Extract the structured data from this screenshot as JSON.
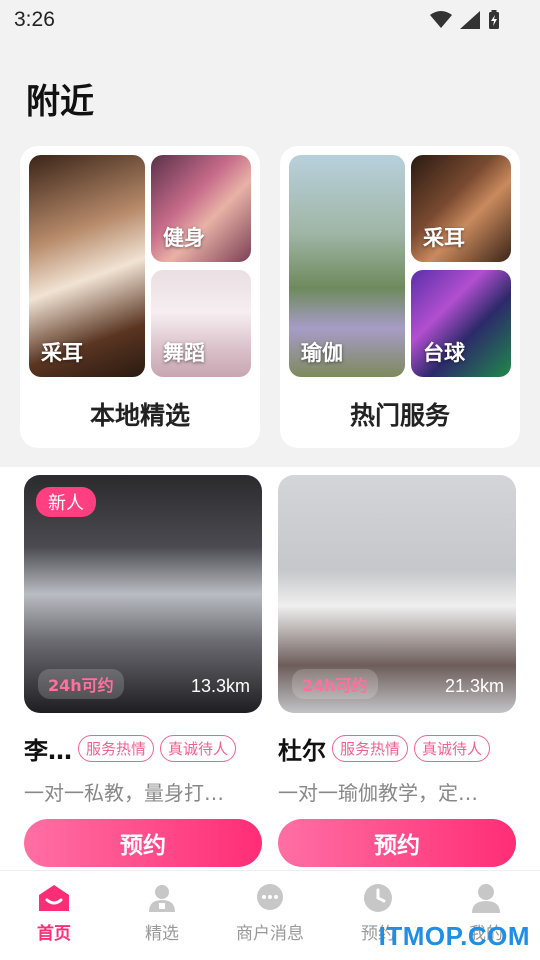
{
  "status_bar": {
    "time": "3:26"
  },
  "page_title": "附近",
  "features": [
    {
      "title": "本地精选",
      "tiles": [
        {
          "label": "采耳"
        },
        {
          "label": "健身"
        },
        {
          "label": "舞蹈"
        }
      ]
    },
    {
      "title": "热门服务",
      "tiles": [
        {
          "label": "瑜伽"
        },
        {
          "label": "采耳"
        },
        {
          "label": "台球"
        }
      ]
    }
  ],
  "coaches": [
    {
      "badge": "新人",
      "availability": "24h可约",
      "distance": "13.3km",
      "name": "李…",
      "tags": [
        "服务热情",
        "真诚待人"
      ],
      "description": "一对一私教，量身打…",
      "book_label": "预约"
    },
    {
      "availability": "24h可约",
      "distance": "21.3km",
      "name": "杜尔",
      "tags": [
        "服务热情",
        "真诚待人"
      ],
      "description": "一对一瑜伽教学，定…",
      "book_label": "预约"
    }
  ],
  "nav": [
    {
      "label": "首页",
      "icon": "home-icon",
      "active": true
    },
    {
      "label": "精选",
      "icon": "person-icon"
    },
    {
      "label": "商户消息",
      "icon": "chat-icon"
    },
    {
      "label": "预约",
      "icon": "clock-icon"
    },
    {
      "label": "我的",
      "icon": "user-icon"
    }
  ],
  "watermark": "ITMOP.COM",
  "colors": {
    "accent": "#ff2d76",
    "tag": "#f2628f"
  }
}
